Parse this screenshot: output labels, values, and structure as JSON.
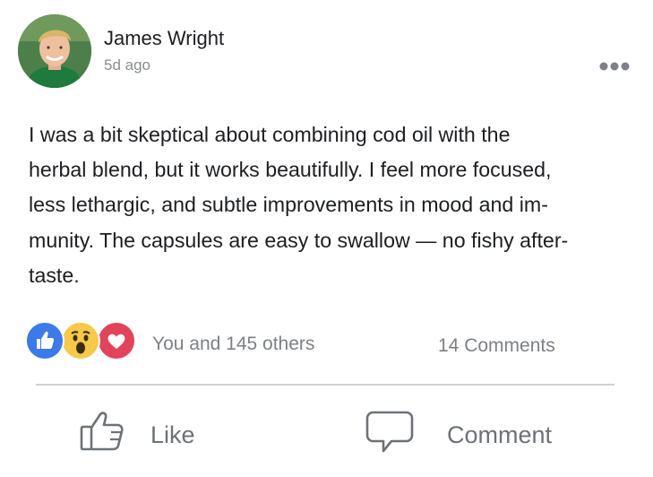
{
  "post": {
    "author": "James Wright",
    "time": "5d ago",
    "text": "I was a bit skeptical about combining cod oil with the\nherbal blend, but it works beautifully. I feel more focused,\nless lethargic, and subtle improvements in mood and im-\nmunity. The capsules are easy to swallow — no fishy after-\ntaste."
  },
  "reactions": {
    "icons": [
      "like-icon",
      "wow-icon",
      "love-icon"
    ],
    "colors": {
      "like": "#3b7ae8",
      "wow": "#f7c948",
      "love": "#e0435a"
    },
    "summary": "You and 145 others",
    "comments": "14 Comments"
  },
  "actions": {
    "like_label": "Like",
    "comment_label": "Comment"
  }
}
